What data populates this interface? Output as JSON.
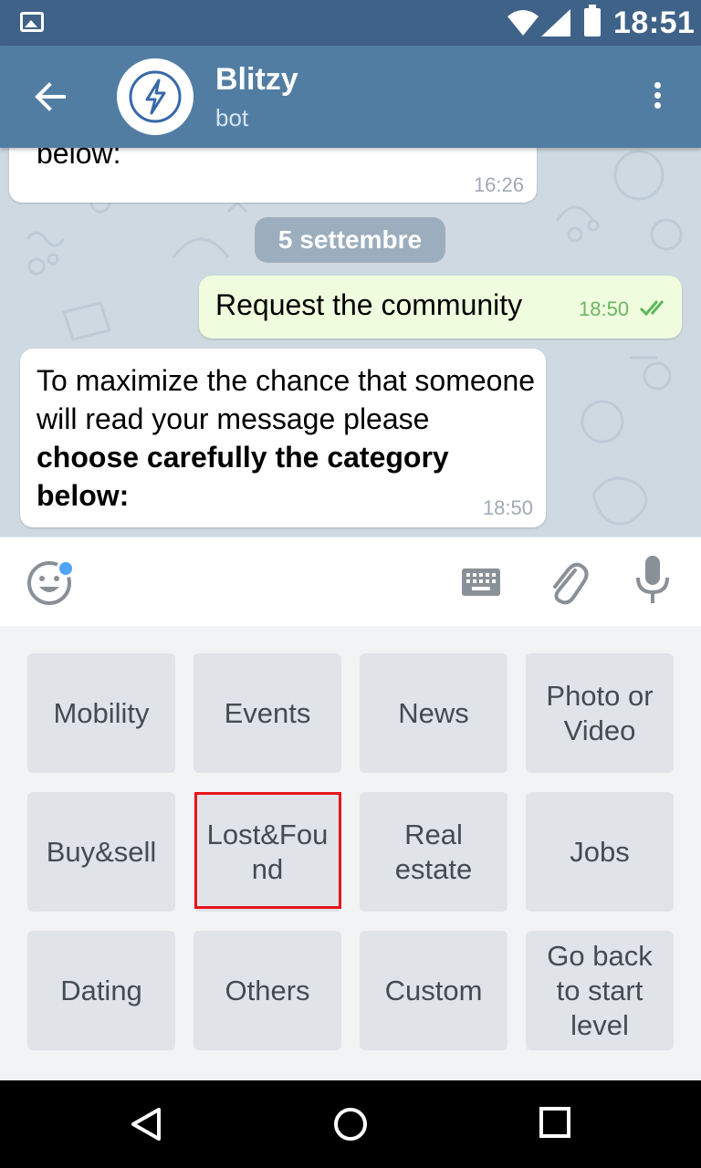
{
  "status_bar": {
    "time": "18:51",
    "icons": [
      "image-notification-icon",
      "wifi-icon",
      "cell-signal-icon",
      "battery-icon"
    ]
  },
  "header": {
    "title": "Blitzy",
    "subtitle": "bot",
    "back_icon": "arrow-left-icon",
    "avatar_icon": "lightning-icon",
    "menu_icon": "more-vertical-icon",
    "color": "#527da3"
  },
  "chat": {
    "messages": [
      {
        "direction": "in",
        "text": "below:",
        "time": "16:26"
      },
      {
        "type": "date",
        "text": "5 settembre"
      },
      {
        "direction": "out",
        "text": "Request the community",
        "time": "18:50",
        "status_icon": "double-check-icon"
      },
      {
        "direction": "in",
        "text_plain": "To maximize the chance that someone will read your message please ",
        "text_bold": "choose carefully the category below:",
        "time": "18:50"
      }
    ],
    "background": "#cfd9e2"
  },
  "input_bar": {
    "icons": [
      "emoji-icon",
      "keyboard-icon",
      "attach-icon",
      "microphone-icon"
    ],
    "notification_dot_color": "#4ea4f6"
  },
  "keyboard": {
    "rows": [
      [
        "Mobility",
        "Events",
        "News",
        "Photo or Video"
      ],
      [
        "Buy&sell",
        "Lost&Found",
        "Real estate",
        "Jobs"
      ],
      [
        "Dating",
        "Others",
        "Custom",
        "Go back to start level"
      ]
    ],
    "highlighted": "Lost&Found",
    "highlight_color": "#e8141c"
  },
  "nav_bar": {
    "icons": [
      "back-triangle-icon",
      "home-circle-icon",
      "recents-square-icon"
    ]
  }
}
